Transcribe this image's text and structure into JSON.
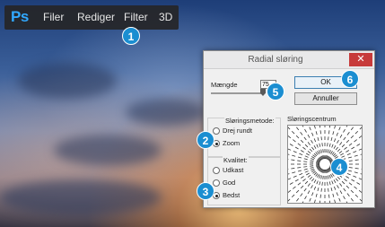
{
  "menubar": {
    "app_logo": "Ps",
    "items": [
      "Filer",
      "Rediger",
      "Filter",
      "3D"
    ]
  },
  "callouts": [
    "1",
    "2",
    "3",
    "4",
    "5",
    "6"
  ],
  "dialog": {
    "title": "Radial sløring",
    "close_glyph": "✕",
    "amount_label": "Mængde",
    "amount_value": "75",
    "ok_label": "OK",
    "cancel_label": "Annuller",
    "method_label": "Sløringsmetode:",
    "methods": [
      {
        "label": "Drej rundt",
        "selected": false
      },
      {
        "label": "Zoom",
        "selected": true
      }
    ],
    "quality_label": "Kvalitet:",
    "qualities": [
      {
        "label": "Udkast",
        "selected": false
      },
      {
        "label": "God",
        "selected": false
      },
      {
        "label": "Bedst",
        "selected": true
      }
    ],
    "center_label": "Sløringscentrum"
  },
  "colors": {
    "badge": "#1b8ed1",
    "ps_logo": "#31a8ff",
    "close_button": "#c73b3b"
  }
}
